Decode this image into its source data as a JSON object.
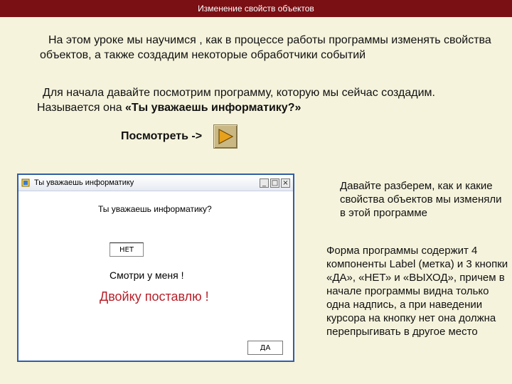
{
  "window_title": "Изменение свойств объектов",
  "intro": {
    "line1": "На этом уроке мы научимся , как в процессе работы программы изменять свойства",
    "line2": "объектов, а также создадим некоторые обработчики событий"
  },
  "lead": {
    "line1": "Для начала давайте посмотрим программу, которую мы сейчас создадим.",
    "line2_prefix": "Называется она ",
    "line2_bold": "«Ты уважаешь информатику?»"
  },
  "view": {
    "label": "Посмотреть ->",
    "icon": "play-triangle-icon"
  },
  "demo_window": {
    "title": "Ты уважаешь информатику",
    "question_label": "Ты уважаешь информатику?",
    "no_button": "НЕТ",
    "look_label": "Смотри у меня !",
    "two_label": "Двойку поставлю !",
    "yes_button": "ДА",
    "controls": {
      "minimize": "_",
      "maximize": "□",
      "close": "×"
    }
  },
  "side_text_1": "Давайте разберем, как и какие свойства объектов мы изменяли в этой программе",
  "side_text_2": "Форма программы содержит 4 компоненты Label (метка) и 3 кнопки «ДА», «НЕТ» и «ВЫХОД», причем в начале программы видна только одна надпись, а при наведении курсора на кнопку нет она должна перепрыгивать в другое место",
  "colors": {
    "title_bar": "#7a0f14",
    "background": "#f5f3dc",
    "accent_red": "#b8202a",
    "window_border": "#2f5ea8"
  }
}
